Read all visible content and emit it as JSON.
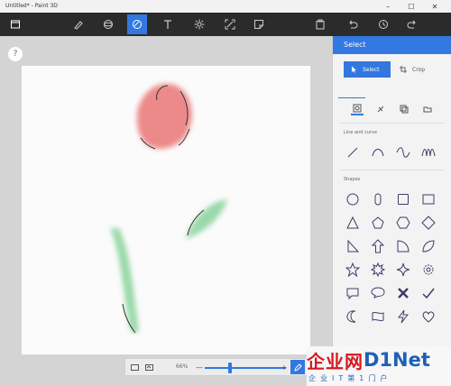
{
  "window": {
    "title": "Untitled* - Paint 3D",
    "minimize_glyph": "–",
    "maximize_glyph": "☐",
    "close_glyph": "✕"
  },
  "toolbar": {
    "items": [
      {
        "name": "menu-icon"
      },
      {
        "name": "brushes-icon"
      },
      {
        "name": "3d-shapes-icon"
      },
      {
        "name": "2d-shapes-icon",
        "active": true
      },
      {
        "name": "text-icon"
      },
      {
        "name": "effects-icon"
      },
      {
        "name": "canvas-icon"
      },
      {
        "name": "stickers-icon"
      },
      {
        "name": "paste-icon"
      },
      {
        "name": "undo-icon"
      },
      {
        "name": "history-icon"
      },
      {
        "name": "redo-icon"
      }
    ]
  },
  "workspace": {
    "help_label": "?"
  },
  "drawing": {
    "description_colors": {
      "petal": "#e86a6a",
      "leaf": "#8fd6a0",
      "stroke": "#333333"
    }
  },
  "zoom": {
    "percent_label": "66%",
    "minus_label": "—",
    "plus_label": "+",
    "level": 0.31
  },
  "panel": {
    "title": "Select",
    "select_label": "Select",
    "crop_label": "Crop",
    "section_lines": "Line and curve",
    "section_shapes": "Shapes"
  },
  "watermark": {
    "main_red": "企业网",
    "main_blue": "D1Net",
    "sub": "企业IT第1门户"
  },
  "colors": {
    "accent": "#3278e0",
    "toolbar_bg": "#2b2b2b"
  }
}
